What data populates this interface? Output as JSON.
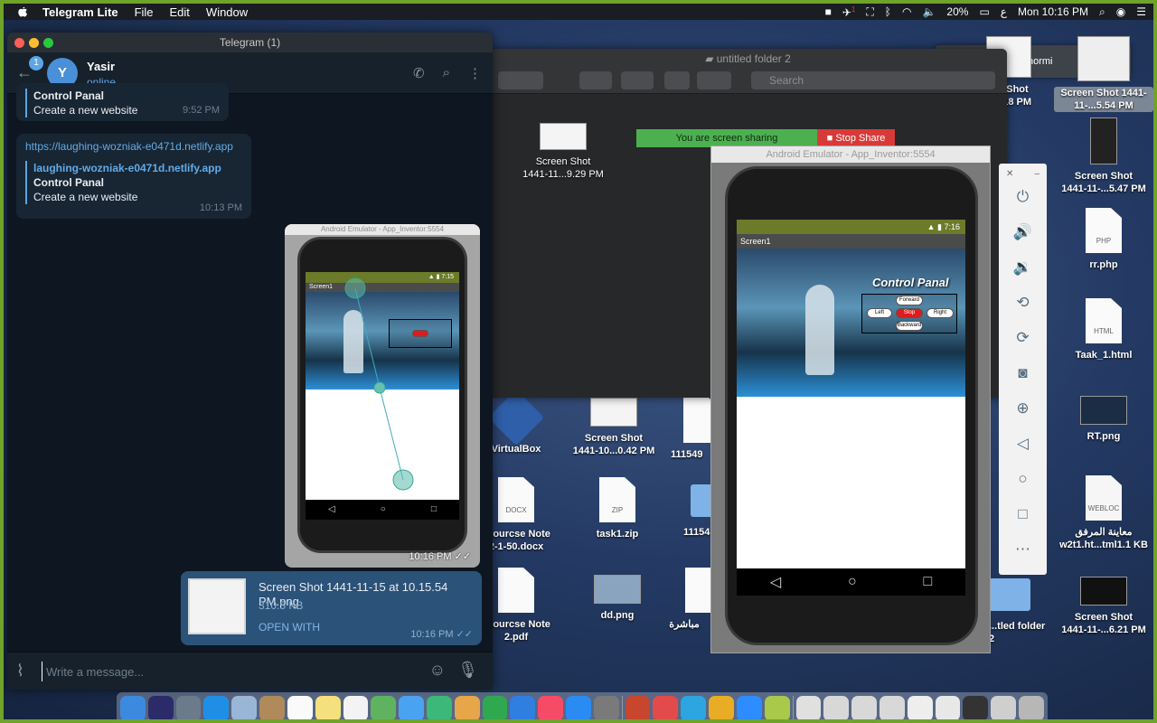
{
  "menubar": {
    "app": "Telegram Lite",
    "menus": [
      "File",
      "Edit",
      "Window"
    ],
    "battery": "20%",
    "keyboard": "ع",
    "clock": "Mon 10:16 PM",
    "notification_count": "1"
  },
  "telegram": {
    "window_title": "Telegram (1)",
    "back_badge": "1",
    "avatar_letter": "Y",
    "contact_name": "Yasir",
    "contact_status": "online",
    "messages": [
      {
        "title": "Control Panal",
        "subtitle": "Create a new website",
        "time": "9:52 PM"
      },
      {
        "link": "https://laughing-wozniak-e0471d.netlify.app",
        "site": "laughing-wozniak-e0471d.netlify.app",
        "title": "Control Panal",
        "subtitle": "Create a new website",
        "time": "10:13 PM"
      }
    ],
    "image_message": {
      "emulator_title": "Android Emulator - App_Inventor:5554",
      "status_time": "7:15",
      "screen_title": "Screen1",
      "time": "10:16 PM"
    },
    "file_message": {
      "file_name": "Screen Shot 1441-11-15 at 10.15.54 PM.png",
      "file_size": "310.5 KB",
      "action": "OPEN WITH",
      "time": "10:16 PM"
    },
    "composer_placeholder": "Write a message..."
  },
  "finder": {
    "title": "untitled folder 2",
    "search_placeholder": "Search",
    "files": [
      {
        "name": "Screen Shot\n1441-11...9.29 PM"
      }
    ]
  },
  "screen_share": {
    "status": "You are screen sharing",
    "stop_label": "Stop Share"
  },
  "talking": "Talking: Yasser Khormi",
  "emulator": {
    "title": "Android Emulator - App_Inventor:5554",
    "status_time": "7:16",
    "screen_title": "Screen1",
    "app_title": "Control Panal",
    "buttons": {
      "forward": "Forward",
      "left": "Left",
      "stop": "Stop",
      "right": "Right",
      "backward": "Backward"
    }
  },
  "desktop_icons": [
    {
      "label": "Screen Shot\n1441-11-...5.54 PM",
      "id": "ss-top"
    },
    {
      "label": "...n Shot\n...6.18 PM",
      "id": "ss-618"
    },
    {
      "label": "Screen Shot\n1441-11-...5.47 PM",
      "id": "ss-547"
    },
    {
      "label": "rr.php",
      "id": "rr",
      "ext": "PHP"
    },
    {
      "label": "Taak_1.html",
      "id": "taak",
      "ext": "HTML"
    },
    {
      "label": "RT.png",
      "id": "rt"
    },
    {
      "label": "معاينة المرفق\nw2t1.ht...tml1.1 KB",
      "id": "webloc",
      "ext": "WEBLOC"
    },
    {
      "label": "Screen Shot\n1441-11-...6.21 PM",
      "id": "ss-621"
    },
    {
      "label": "VirtualBox",
      "id": "vbox"
    },
    {
      "label": "Screen Shot\n1441-10...0.42 PM",
      "id": "ss-042"
    },
    {
      "label": "111549",
      "id": "n111549"
    },
    {
      "label": "l courcse Note\n2-1-50.docx",
      "id": "docx",
      "ext": "DOCX"
    },
    {
      "label": "task1.zip",
      "id": "zip",
      "ext": "ZIP"
    },
    {
      "label": "11154",
      "id": "n11154"
    },
    {
      "label": "l courcse Note\n2.pdf",
      "id": "pdf"
    },
    {
      "label": "dd.png",
      "id": "dd"
    },
    {
      "label": "مباشرة",
      "id": "arabic"
    },
    {
      "label": "...tled folder 2",
      "id": "folder2"
    }
  ]
}
